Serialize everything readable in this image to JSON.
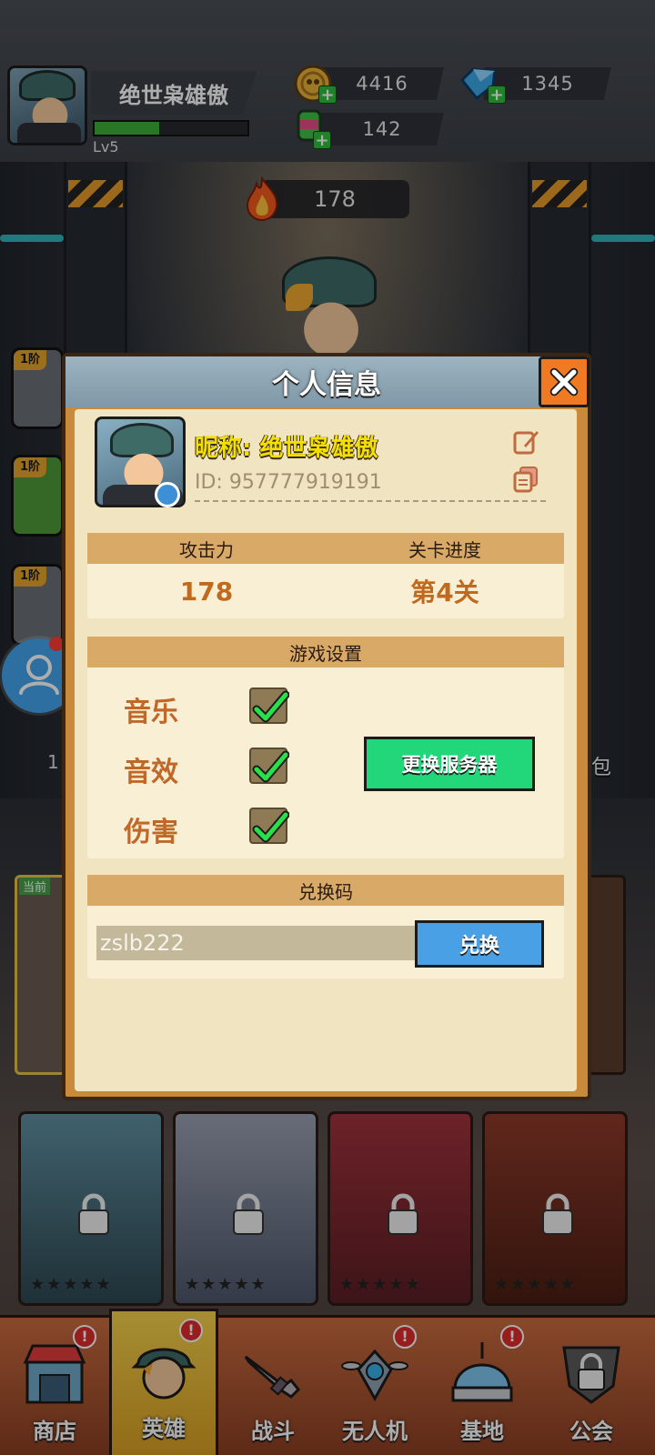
{
  "hud": {
    "player_name": "绝世枭雄傲",
    "level": "Lv5",
    "exp_fraction": 0.42,
    "gold": "4416",
    "gems": "1345",
    "energy": "142",
    "power": "178"
  },
  "gear_slots": [
    {
      "tier": "1阶"
    },
    {
      "tier": "1阶"
    },
    {
      "tier": "1阶"
    }
  ],
  "side_fragments": {
    "left_text": "1",
    "right_text": "包",
    "current_tag": "当前"
  },
  "modal": {
    "title": "个人信息",
    "nickname": "昵称: 绝世枭雄傲",
    "player_id": "ID: 957777919191",
    "stats": {
      "attack_label": "攻击力",
      "progress_label": "关卡进度",
      "attack_value": "178",
      "progress_value": "第4关"
    },
    "settings": {
      "header": "游戏设置",
      "music_label": "音乐",
      "sfx_label": "音效",
      "damage_label": "伤害",
      "music_checked": true,
      "sfx_checked": true,
      "damage_checked": true,
      "server_button": "更换服务器"
    },
    "redeem": {
      "header": "兑换码",
      "code_value": "zslb222",
      "button": "兑换"
    }
  },
  "bottom_nav": [
    {
      "label": "商店",
      "badge": "!"
    },
    {
      "label": "英雄",
      "badge": "!"
    },
    {
      "label": "战斗",
      "badge": ""
    },
    {
      "label": "无人机",
      "badge": "!"
    },
    {
      "label": "基地",
      "badge": "!"
    },
    {
      "label": "公会",
      "badge": ""
    }
  ],
  "colors": {
    "modal_header": "#8fa7b5",
    "close_button": "#f07a24",
    "server_button": "#22d67a",
    "redeem_button": "#4aa0e4",
    "nickname": "#f4e000",
    "stat_value": "#c06a1f"
  }
}
